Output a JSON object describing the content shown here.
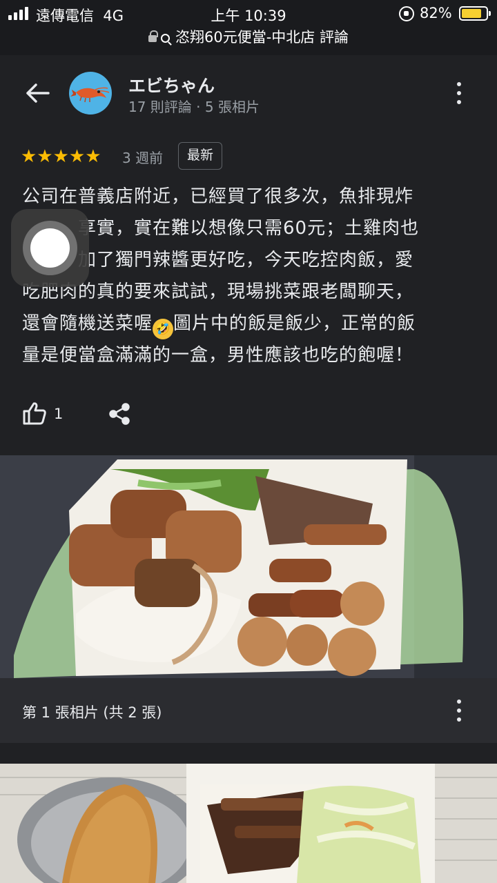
{
  "status_bar": {
    "carrier": "遠傳電信",
    "network": "4G",
    "time": "上午 10:39",
    "battery": "82%",
    "battery_level": 0.82
  },
  "url_bar": {
    "title": "恣翔60元便當-中北店 評論"
  },
  "reviewer": {
    "name": "エビちゃん",
    "stats": "17 則評論 · 5 張相片"
  },
  "rating": {
    "stars": 5,
    "star_glyphs": "★★★★★",
    "time_ago": "3 週前",
    "badge": "最新"
  },
  "review": {
    "text_1": "公司在普義店附近，已經買了很多次，魚排現炸\n　　　享實，實在難以想像只需60元；土雞肉也\n　　　加了獨門辣醬更好吃，今天吃控肉飯，愛\n吃肥肉的真的要來試試，現場挑菜跟老闆聊天，\n還會隨機送菜喔",
    "emoji": "🤣",
    "text_2": "圖片中的飯是飯少，正常的飯\n量是便當盒滿滿的一盒，男性應該也吃的飽喔！"
  },
  "actions": {
    "like_count": "1"
  },
  "photo_caption": "第 1 張相片 (共 2 張)",
  "colors": {
    "background": "#202124",
    "star": "#fbbc04",
    "avatar": "#4fb3e6",
    "battery": "#f7d031"
  },
  "icons": [
    "back-arrow-icon",
    "more-vert-icon",
    "thumbs-up-icon",
    "share-icon",
    "lock-icon",
    "search-icon",
    "assistive-touch-button"
  ]
}
